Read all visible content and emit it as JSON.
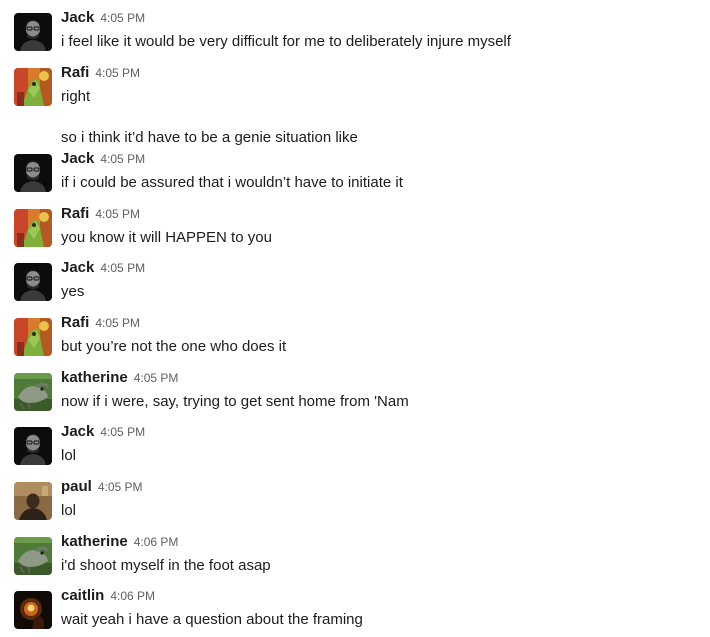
{
  "messages": [
    {
      "author": "Jack",
      "avatar": "jack-avatar",
      "time": "4:05 PM",
      "lines": [
        "i feel like it would be very difficult for me to deliberately injure myself"
      ]
    },
    {
      "author": "Rafi",
      "avatar": "rafi-avatar",
      "time": "4:05 PM",
      "lines": [
        "right",
        "so i think it’d have to be a genie situation like"
      ]
    },
    {
      "author": "Jack",
      "avatar": "jack-avatar",
      "time": "4:05 PM",
      "lines": [
        "if i could be assured that i wouldn’t have to initiate it"
      ]
    },
    {
      "author": "Rafi",
      "avatar": "rafi-avatar",
      "time": "4:05 PM",
      "lines": [
        "you know it will HAPPEN to you"
      ]
    },
    {
      "author": "Jack",
      "avatar": "jack-avatar",
      "time": "4:05 PM",
      "lines": [
        "yes"
      ]
    },
    {
      "author": "Rafi",
      "avatar": "rafi-avatar",
      "time": "4:05 PM",
      "lines": [
        "but you’re not the one who does it"
      ]
    },
    {
      "author": "katherine",
      "avatar": "katherine-avatar",
      "time": "4:05 PM",
      "lines": [
        "now if i were, say, trying to get sent home from 'Nam"
      ]
    },
    {
      "author": "Jack",
      "avatar": "jack-avatar",
      "time": "4:05 PM",
      "lines": [
        "lol"
      ]
    },
    {
      "author": "paul",
      "avatar": "paul-avatar",
      "time": "4:05 PM",
      "lines": [
        "lol"
      ]
    },
    {
      "author": "katherine",
      "avatar": "katherine-avatar",
      "time": "4:06 PM",
      "lines": [
        "i'd shoot myself in the foot asap"
      ]
    },
    {
      "author": "caitlin",
      "avatar": "caitlin-avatar",
      "time": "4:06 PM",
      "lines": [
        "wait yeah i have a question about the framing"
      ]
    }
  ]
}
